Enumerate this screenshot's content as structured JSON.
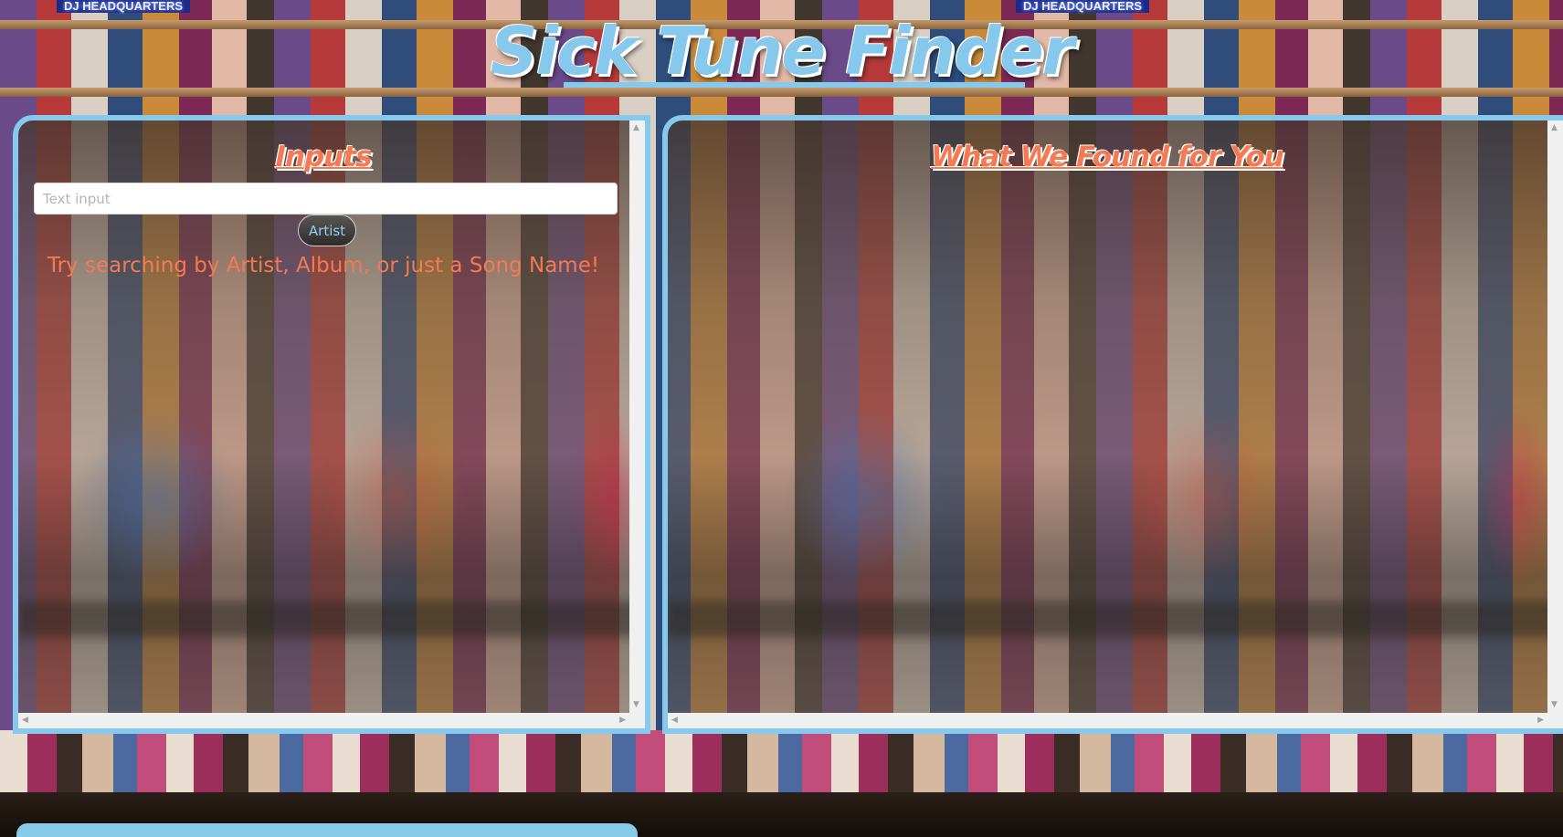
{
  "header": {
    "title": "Sick Tune Finder",
    "sign_left": "DJ HEADQUARTERS",
    "sign_right": "DJ HEADQUARTERS"
  },
  "inputs_panel": {
    "heading": "Inputs",
    "search": {
      "placeholder": "Text input",
      "value": ""
    },
    "artist_button_label": "Artist",
    "hint": "Try searching by Artist, Album, or just a Song Name!"
  },
  "results_panel": {
    "heading": "What We Found for You"
  },
  "colors": {
    "accent_blue": "#86c9ec",
    "heading_orange": "#f47a53"
  },
  "icons": {
    "scroll_up": "▲",
    "scroll_down": "▼",
    "scroll_left": "◀",
    "scroll_right": "▶"
  }
}
